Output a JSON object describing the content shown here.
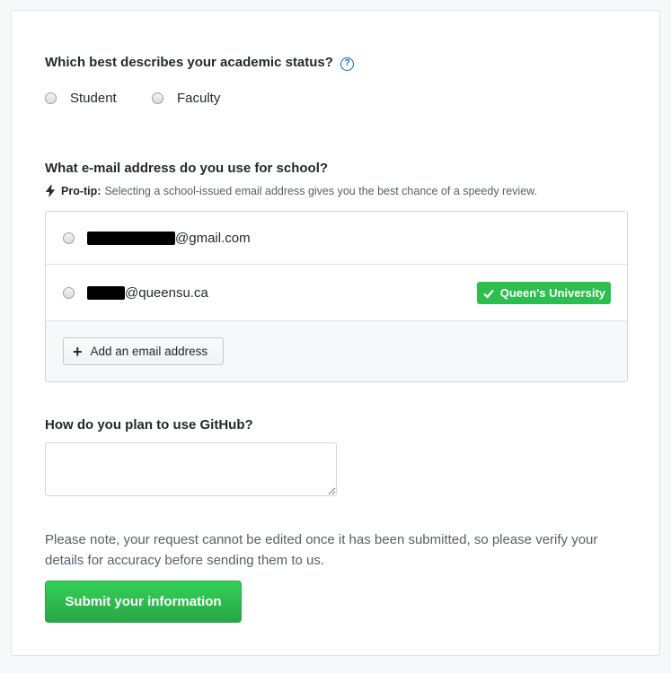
{
  "status_section": {
    "question": "Which best describes your academic status?",
    "help_icon": "question-circle-icon",
    "options": [
      {
        "label": "Student",
        "selected": false
      },
      {
        "label": "Faculty",
        "selected": false
      }
    ]
  },
  "email_section": {
    "question": "What e-mail address do you use for school?",
    "tip_icon": "lightning-bolt-icon",
    "tip_label": "Pro-tip:",
    "tip_text": "Selecting a school-issued email address gives you the best chance of a speedy review.",
    "emails": [
      {
        "domain": "@gmail.com",
        "redacted": true,
        "badge": ""
      },
      {
        "domain": "@queensu.ca",
        "redacted": true,
        "badge": "Queen's University"
      }
    ],
    "add_button_label": "Add an email address",
    "badge_color": "#2cbe4e"
  },
  "usage_section": {
    "question": "How do you plan to use GitHub?",
    "value": "",
    "placeholder": ""
  },
  "note": "Please note, your request cannot be edited once it has been submitted, so please verify your details for accuracy before sending them to us.",
  "submit_label": "Submit your information",
  "colors": {
    "submit_green": "#28a745",
    "link_blue": "#0366d6"
  }
}
